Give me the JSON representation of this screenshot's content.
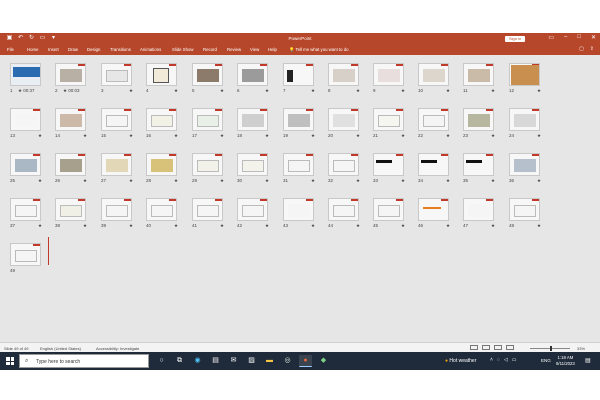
{
  "window": {
    "title": "PowerPoint",
    "sign_in": "Sign in",
    "qat_icons": [
      "save-icon",
      "undo-icon",
      "redo-icon",
      "present-icon",
      "customize-icon"
    ],
    "window_controls": [
      "ribbon-display-icon",
      "minimize-icon",
      "maximize-icon",
      "close-icon"
    ]
  },
  "ribbon": {
    "tabs": [
      "File",
      "Home",
      "Insert",
      "Draw",
      "Design",
      "Transitions",
      "Animations",
      "Slide Show",
      "Record",
      "Review",
      "View",
      "Help"
    ],
    "tell_me": "Tell me what you want to do",
    "tell_me_icon": "lightbulb-icon",
    "right_icons": [
      "comments-icon",
      "share-icon"
    ]
  },
  "slides": [
    {
      "n": "1",
      "timing": "00:37"
    },
    {
      "n": "2",
      "timing": "00:03"
    },
    {
      "n": "3"
    },
    {
      "n": "4"
    },
    {
      "n": "5"
    },
    {
      "n": "6"
    },
    {
      "n": "7"
    },
    {
      "n": "8"
    },
    {
      "n": "9"
    },
    {
      "n": "10"
    },
    {
      "n": "11"
    },
    {
      "n": "12"
    },
    {
      "n": "13"
    },
    {
      "n": "14"
    },
    {
      "n": "15"
    },
    {
      "n": "16"
    },
    {
      "n": "17"
    },
    {
      "n": "18"
    },
    {
      "n": "19"
    },
    {
      "n": "20"
    },
    {
      "n": "21"
    },
    {
      "n": "22"
    },
    {
      "n": "23"
    },
    {
      "n": "24"
    },
    {
      "n": "25"
    },
    {
      "n": "26"
    },
    {
      "n": "27"
    },
    {
      "n": "28"
    },
    {
      "n": "29"
    },
    {
      "n": "30"
    },
    {
      "n": "31"
    },
    {
      "n": "32"
    },
    {
      "n": "33"
    },
    {
      "n": "34"
    },
    {
      "n": "35"
    },
    {
      "n": "36"
    },
    {
      "n": "37"
    },
    {
      "n": "38"
    },
    {
      "n": "39"
    },
    {
      "n": "40"
    },
    {
      "n": "41"
    },
    {
      "n": "42"
    },
    {
      "n": "43"
    },
    {
      "n": "44"
    },
    {
      "n": "45"
    },
    {
      "n": "46"
    },
    {
      "n": "47"
    },
    {
      "n": "48"
    },
    {
      "n": "49"
    }
  ],
  "transition_marker": "★",
  "status": {
    "slide_count": "Slide 49 of 49",
    "language": "English (United States)",
    "accessibility": "Accessibility: Investigate",
    "zoom": "33%"
  },
  "taskbar": {
    "search_placeholder": "Type here to search",
    "search_icon": "search-icon",
    "apps": [
      "cortana-icon",
      "task-view-icon",
      "edge-icon",
      "store-icon",
      "mail-icon",
      "photos-icon",
      "file-explorer-icon",
      "chrome-icon",
      "powerpoint-icon",
      "extra-app-icon"
    ],
    "weather": "Hot weather",
    "tray_icons": [
      "show-hidden-icons",
      "network-icon",
      "volume-icon",
      "battery-icon"
    ],
    "language": "ENG",
    "time": "1:18 AM",
    "date": "9/11/2023"
  },
  "colors": {
    "accent": "#b7472a",
    "slide_red": "#c0392b",
    "sorter_bg": "#e6e6e6",
    "taskbar_bg": "#1f2b3a"
  }
}
